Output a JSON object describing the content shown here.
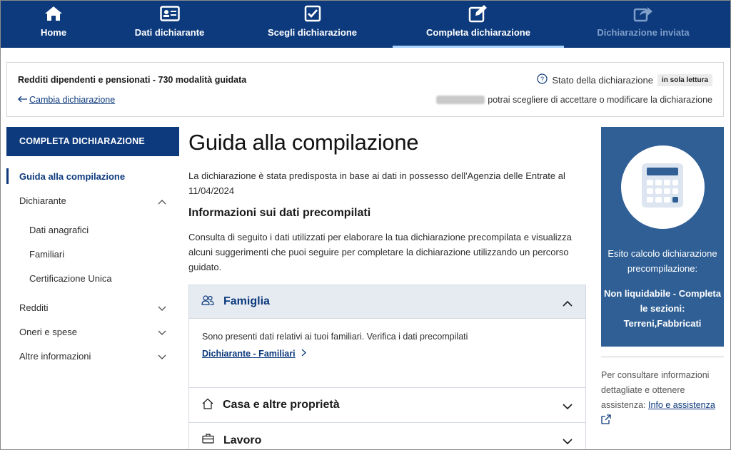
{
  "nav": {
    "steps": [
      {
        "label": "Home",
        "icon": "home-icon",
        "state": "done"
      },
      {
        "label": "Dati dichiarante",
        "icon": "id-card-icon",
        "state": "done"
      },
      {
        "label": "Scegli dichiarazione",
        "icon": "checkbox-icon",
        "state": "done"
      },
      {
        "label": "Completa dichiarazione",
        "icon": "edit-icon",
        "state": "active"
      },
      {
        "label": "Dichiarazione inviata",
        "icon": "share-icon",
        "state": "disabled"
      }
    ]
  },
  "summary": {
    "title": "Redditi dipendenti e pensionati - 730 modalità guidata",
    "back_label": "Cambia dichiarazione",
    "state_label": "Stato della dichiarazione",
    "state_badge": "in sola lettura",
    "note": "potrai scegliere di accettare o modificare la dichiarazione"
  },
  "sidebar": {
    "header": "COMPLETA DICHIARAZIONE",
    "items": [
      {
        "label": "Guida alla compilazione"
      },
      {
        "label": "Dichiarante"
      },
      {
        "label": "Dati anagrafici"
      },
      {
        "label": "Familiari"
      },
      {
        "label": "Certificazione Unica"
      },
      {
        "label": "Redditi"
      },
      {
        "label": "Oneri e spese"
      },
      {
        "label": "Altre informazioni"
      }
    ]
  },
  "main": {
    "title": "Guida alla compilazione",
    "lead": "La dichiarazione è stata predisposta in base ai dati in possesso dell'Agenzia delle Entrate al 11/04/2024",
    "subtitle": "Informazioni sui dati precompilati",
    "description": "Consulta di seguito i dati utilizzati per elaborare la tua dichiarazione precompilata e visualizza alcuni suggerimenti che puoi seguire per completare la dichiarazione utilizzando un percorso guidato.",
    "famiglia": {
      "label": "Famiglia",
      "body": "Sono presenti dati relativi ai tuoi familiari. Verifica i dati precompilati",
      "link": "Dichiarante - Familiari"
    },
    "casa": {
      "label": "Casa e altre proprietà"
    },
    "lavoro": {
      "label": "Lavoro"
    }
  },
  "card": {
    "caption": "Esito calcolo dichiarazione precompilazione:",
    "result": "Non liquidabile - Completa le sezioni: Terreni,Fabbricati"
  },
  "help": {
    "text": "Per consultare informazioni dettagliate e ottenere assistenza:",
    "link": "Info e assistenza"
  },
  "colors": {
    "brand": "#0d3a7d",
    "card": "#2f5f95",
    "accordion_header": "#e6ebf2"
  }
}
